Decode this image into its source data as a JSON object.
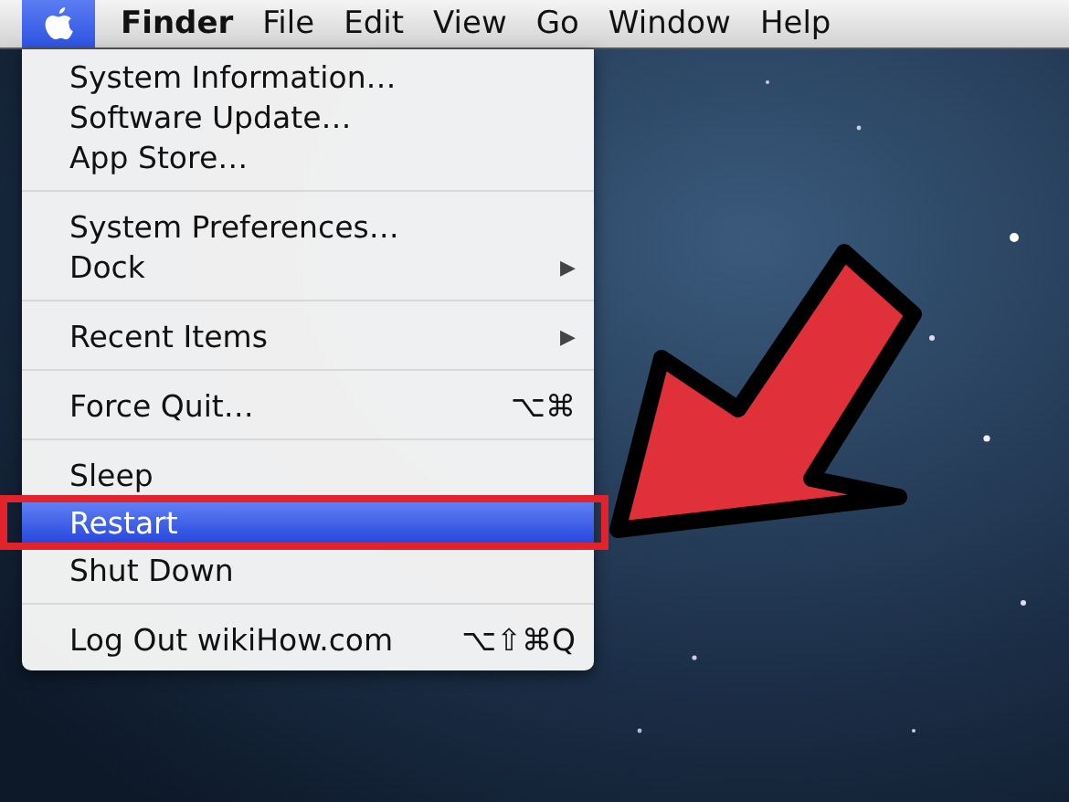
{
  "menu_bar": {
    "apple_menu": {
      "selected": true
    },
    "items": [
      {
        "label": "Finder",
        "kind": "app"
      },
      {
        "label": "File",
        "kind": "menu"
      },
      {
        "label": "Edit",
        "kind": "menu"
      },
      {
        "label": "View",
        "kind": "menu"
      },
      {
        "label": "Go",
        "kind": "menu"
      },
      {
        "label": "Window",
        "kind": "menu"
      },
      {
        "label": "Help",
        "kind": "menu"
      }
    ]
  },
  "apple_menu": {
    "entries": [
      {
        "kind": "item",
        "label": "System Information…",
        "selected": false
      },
      {
        "kind": "item",
        "label": "Software Update…",
        "selected": false
      },
      {
        "kind": "item",
        "label": "App Store…",
        "selected": false
      },
      {
        "kind": "separator"
      },
      {
        "kind": "item",
        "label": "System Preferences…",
        "selected": false
      },
      {
        "kind": "item",
        "label": "Dock",
        "submenu": "▶",
        "selected": false
      },
      {
        "kind": "separator"
      },
      {
        "kind": "item",
        "label": "Recent Items",
        "submenu": "▶",
        "selected": false
      },
      {
        "kind": "separator"
      },
      {
        "kind": "item",
        "label": "Force Quit…",
        "shortcut": "⌥⌘",
        "selected": false
      },
      {
        "kind": "separator"
      },
      {
        "kind": "item",
        "label": "Sleep",
        "selected": false
      },
      {
        "kind": "item",
        "label": "Restart",
        "selected": true
      },
      {
        "kind": "item",
        "label": "Shut Down",
        "selected": false
      },
      {
        "kind": "separator"
      },
      {
        "kind": "item",
        "label": "Log Out wikiHow.com",
        "shortcut": "⌥⇧⌘Q",
        "selected": false
      }
    ]
  }
}
